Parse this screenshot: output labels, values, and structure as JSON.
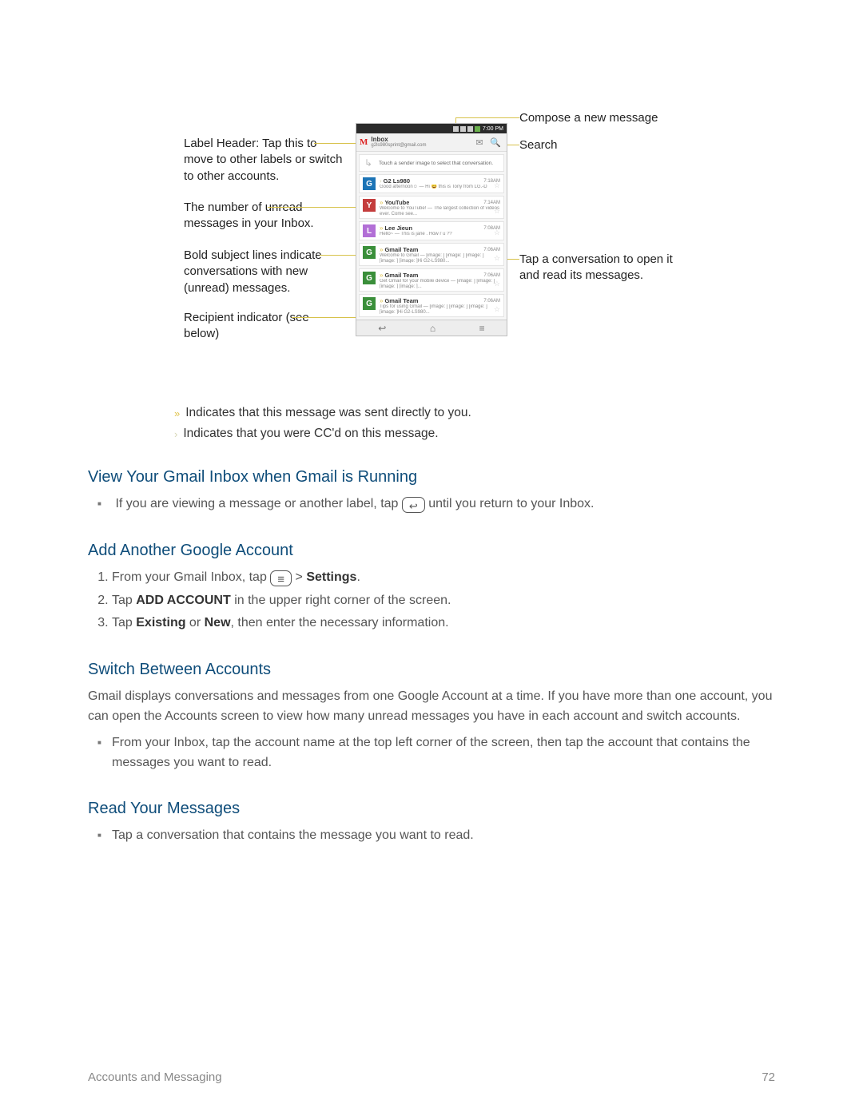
{
  "left_ann": {
    "label_header": "Label Header: Tap this to move to other labels or switch to other accounts.",
    "unread_count": "The number of unread messages in your Inbox.",
    "bold_subject": "Bold subject lines indicate conversations with new (unread) messages.",
    "recipient": "Recipient indicator (see below)"
  },
  "right_ann": {
    "compose": "Compose a new message",
    "search": "Search",
    "tap_open": "Tap a conversation to open it and read its messages."
  },
  "phone": {
    "time": "7:00 PM",
    "inbox": "Inbox",
    "account": "g2ls980sprint@gmail.com",
    "helper": "Touch a sender image to select that conversation.",
    "rows": [
      {
        "avatar": "G",
        "cls": "av-g1",
        "chev": "single",
        "sender": "G2 Ls980",
        "time": "7:18AM",
        "preview": "Good afternoon☺ — Hi &#128516; this is Tony from LG.-D"
      },
      {
        "avatar": "Y",
        "cls": "av-y",
        "chev": "double",
        "sender": "YouTube",
        "time": "7:14AM",
        "preview": "Welcome to YouTube! — The largest collection of videos ever. Come see..."
      },
      {
        "avatar": "L",
        "cls": "av-l",
        "chev": "double",
        "sender": "Lee Jieun",
        "time": "7:08AM",
        "preview": "Hello~ — This is jane . How r u ??"
      },
      {
        "avatar": "G",
        "cls": "av-g",
        "chev": "double",
        "sender": "Gmail Team",
        "time": "7:06AM",
        "preview": "Welcome to Gmail — [image: ] [image: ] [image: ] [image: ] [image: ]Hi G2-LS980..."
      },
      {
        "avatar": "G",
        "cls": "av-g",
        "chev": "double",
        "sender": "Gmail Team",
        "time": "7:06AM",
        "preview": "Get Gmail for your mobile device — [image: ] [image: ] [image: ] [image: ]..."
      },
      {
        "avatar": "G",
        "cls": "av-g",
        "chev": "double",
        "sender": "Gmail Team",
        "time": "7:06AM",
        "preview": "Tips for using Gmail — [image: ] [image: ] [image: ] [image: ]Hi G2-LS980..."
      }
    ]
  },
  "legend1": "Indicates that this message was sent directly to you.",
  "legend2": "Indicates that you were CC'd on this message.",
  "sec1": {
    "title": "View Your Gmail Inbox when Gmail is Running",
    "bullet_a": "If you are viewing a message or another label, tap",
    "bullet_b": "until you return to your Inbox."
  },
  "sec2": {
    "title": "Add Another Google Account",
    "s1a": "From your Gmail Inbox, tap",
    "s1b": "> ",
    "s1c": "Settings",
    "s1d": ".",
    "s2a": "Tap ",
    "s2b": "ADD ACCOUNT",
    "s2c": " in the upper right corner of the screen.",
    "s3a": "Tap ",
    "s3b": "Existing",
    "s3c": " or ",
    "s3d": "New",
    "s3e": ", then enter the necessary information."
  },
  "sec3": {
    "title": "Switch Between Accounts",
    "para": "Gmail displays conversations and messages from one Google Account at a time. If you have more than one account, you can open the Accounts screen to view how many unread messages you have in each account and switch accounts.",
    "bullet": "From your Inbox, tap the account name at the top left corner of the screen, then tap the account that contains the messages you want to read."
  },
  "sec4": {
    "title": "Read Your Messages",
    "bullet": "Tap a conversation that contains the message you want to read."
  },
  "footer": {
    "left": "Accounts and Messaging",
    "right": "72"
  }
}
